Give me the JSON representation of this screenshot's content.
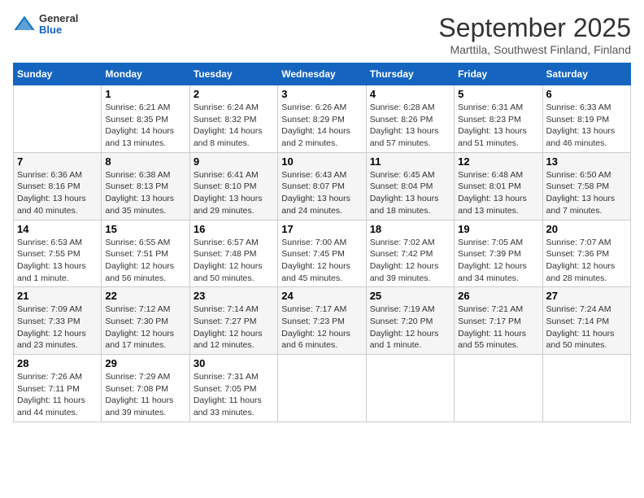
{
  "app": {
    "name": "GeneralBlue",
    "logo_text_top": "General",
    "logo_text_bottom": "Blue"
  },
  "header": {
    "month": "September 2025",
    "location": "Marttila, Southwest Finland, Finland"
  },
  "weekdays": [
    "Sunday",
    "Monday",
    "Tuesday",
    "Wednesday",
    "Thursday",
    "Friday",
    "Saturday"
  ],
  "weeks": [
    [
      {
        "day": "",
        "info": ""
      },
      {
        "day": "1",
        "info": "Sunrise: 6:21 AM\nSunset: 8:35 PM\nDaylight: 14 hours\nand 13 minutes."
      },
      {
        "day": "2",
        "info": "Sunrise: 6:24 AM\nSunset: 8:32 PM\nDaylight: 14 hours\nand 8 minutes."
      },
      {
        "day": "3",
        "info": "Sunrise: 6:26 AM\nSunset: 8:29 PM\nDaylight: 14 hours\nand 2 minutes."
      },
      {
        "day": "4",
        "info": "Sunrise: 6:28 AM\nSunset: 8:26 PM\nDaylight: 13 hours\nand 57 minutes."
      },
      {
        "day": "5",
        "info": "Sunrise: 6:31 AM\nSunset: 8:23 PM\nDaylight: 13 hours\nand 51 minutes."
      },
      {
        "day": "6",
        "info": "Sunrise: 6:33 AM\nSunset: 8:19 PM\nDaylight: 13 hours\nand 46 minutes."
      }
    ],
    [
      {
        "day": "7",
        "info": "Sunrise: 6:36 AM\nSunset: 8:16 PM\nDaylight: 13 hours\nand 40 minutes."
      },
      {
        "day": "8",
        "info": "Sunrise: 6:38 AM\nSunset: 8:13 PM\nDaylight: 13 hours\nand 35 minutes."
      },
      {
        "day": "9",
        "info": "Sunrise: 6:41 AM\nSunset: 8:10 PM\nDaylight: 13 hours\nand 29 minutes."
      },
      {
        "day": "10",
        "info": "Sunrise: 6:43 AM\nSunset: 8:07 PM\nDaylight: 13 hours\nand 24 minutes."
      },
      {
        "day": "11",
        "info": "Sunrise: 6:45 AM\nSunset: 8:04 PM\nDaylight: 13 hours\nand 18 minutes."
      },
      {
        "day": "12",
        "info": "Sunrise: 6:48 AM\nSunset: 8:01 PM\nDaylight: 13 hours\nand 13 minutes."
      },
      {
        "day": "13",
        "info": "Sunrise: 6:50 AM\nSunset: 7:58 PM\nDaylight: 13 hours\nand 7 minutes."
      }
    ],
    [
      {
        "day": "14",
        "info": "Sunrise: 6:53 AM\nSunset: 7:55 PM\nDaylight: 13 hours\nand 1 minute."
      },
      {
        "day": "15",
        "info": "Sunrise: 6:55 AM\nSunset: 7:51 PM\nDaylight: 12 hours\nand 56 minutes."
      },
      {
        "day": "16",
        "info": "Sunrise: 6:57 AM\nSunset: 7:48 PM\nDaylight: 12 hours\nand 50 minutes."
      },
      {
        "day": "17",
        "info": "Sunrise: 7:00 AM\nSunset: 7:45 PM\nDaylight: 12 hours\nand 45 minutes."
      },
      {
        "day": "18",
        "info": "Sunrise: 7:02 AM\nSunset: 7:42 PM\nDaylight: 12 hours\nand 39 minutes."
      },
      {
        "day": "19",
        "info": "Sunrise: 7:05 AM\nSunset: 7:39 PM\nDaylight: 12 hours\nand 34 minutes."
      },
      {
        "day": "20",
        "info": "Sunrise: 7:07 AM\nSunset: 7:36 PM\nDaylight: 12 hours\nand 28 minutes."
      }
    ],
    [
      {
        "day": "21",
        "info": "Sunrise: 7:09 AM\nSunset: 7:33 PM\nDaylight: 12 hours\nand 23 minutes."
      },
      {
        "day": "22",
        "info": "Sunrise: 7:12 AM\nSunset: 7:30 PM\nDaylight: 12 hours\nand 17 minutes."
      },
      {
        "day": "23",
        "info": "Sunrise: 7:14 AM\nSunset: 7:27 PM\nDaylight: 12 hours\nand 12 minutes."
      },
      {
        "day": "24",
        "info": "Sunrise: 7:17 AM\nSunset: 7:23 PM\nDaylight: 12 hours\nand 6 minutes."
      },
      {
        "day": "25",
        "info": "Sunrise: 7:19 AM\nSunset: 7:20 PM\nDaylight: 12 hours\nand 1 minute."
      },
      {
        "day": "26",
        "info": "Sunrise: 7:21 AM\nSunset: 7:17 PM\nDaylight: 11 hours\nand 55 minutes."
      },
      {
        "day": "27",
        "info": "Sunrise: 7:24 AM\nSunset: 7:14 PM\nDaylight: 11 hours\nand 50 minutes."
      }
    ],
    [
      {
        "day": "28",
        "info": "Sunrise: 7:26 AM\nSunset: 7:11 PM\nDaylight: 11 hours\nand 44 minutes."
      },
      {
        "day": "29",
        "info": "Sunrise: 7:29 AM\nSunset: 7:08 PM\nDaylight: 11 hours\nand 39 minutes."
      },
      {
        "day": "30",
        "info": "Sunrise: 7:31 AM\nSunset: 7:05 PM\nDaylight: 11 hours\nand 33 minutes."
      },
      {
        "day": "",
        "info": ""
      },
      {
        "day": "",
        "info": ""
      },
      {
        "day": "",
        "info": ""
      },
      {
        "day": "",
        "info": ""
      }
    ]
  ]
}
